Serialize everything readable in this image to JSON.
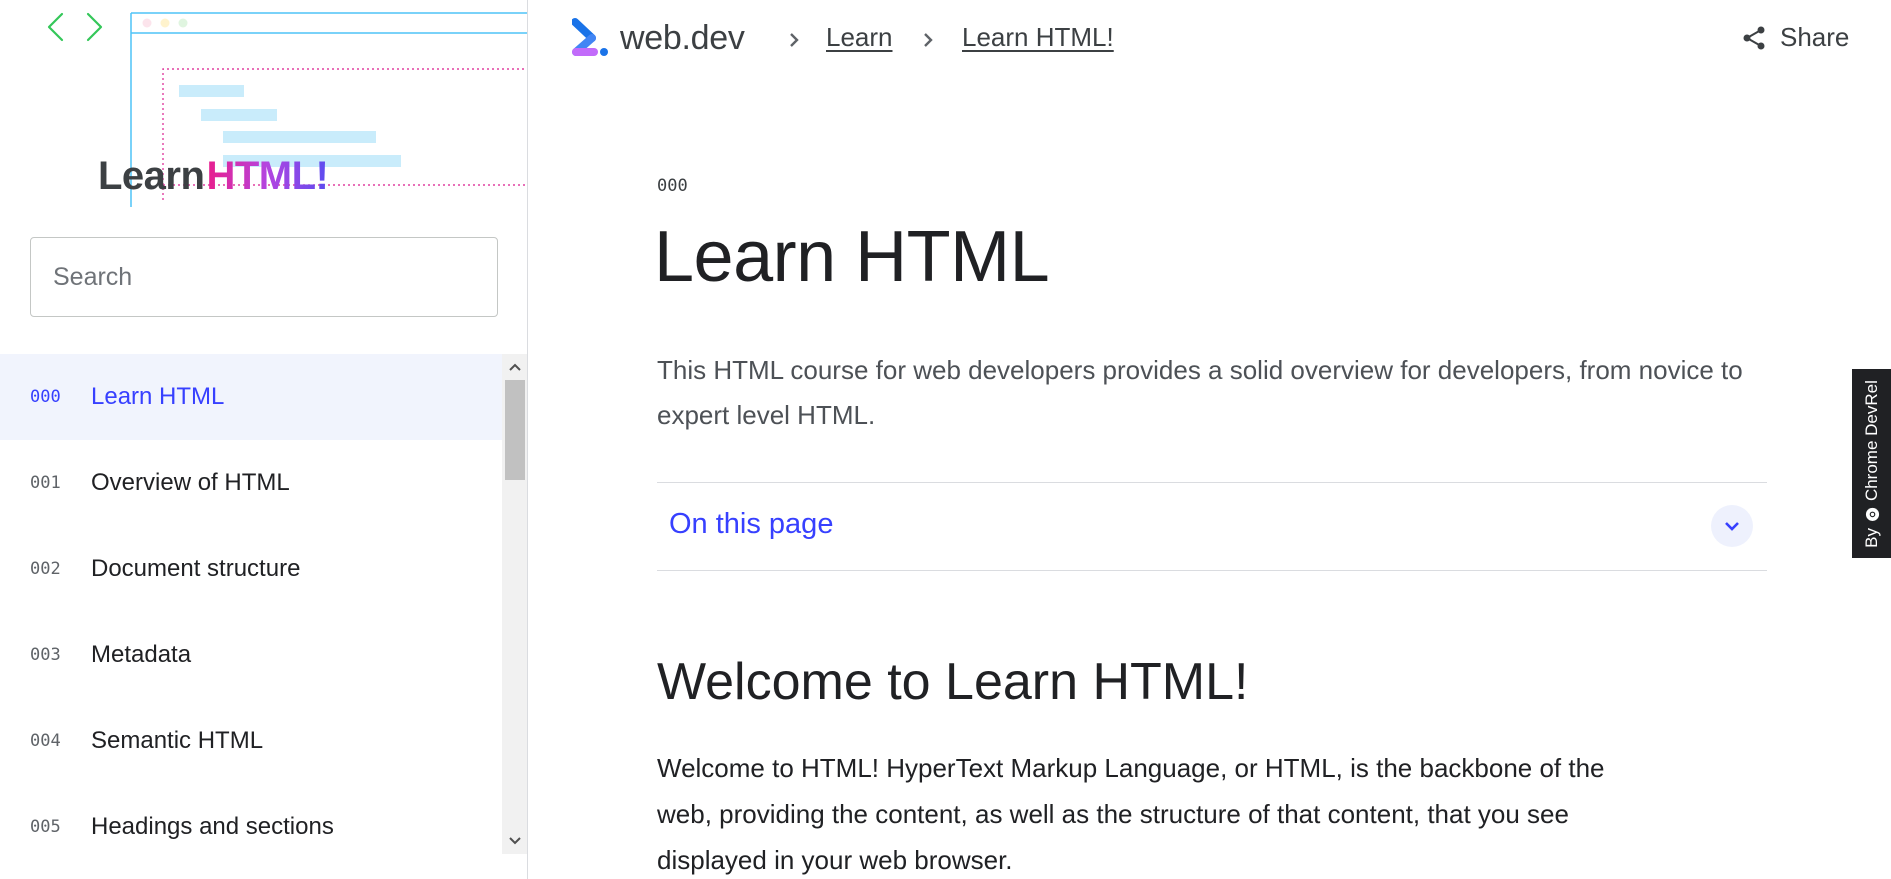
{
  "sidebar": {
    "hero": {
      "title_word1": "Learn",
      "title_word2": "HTML!"
    },
    "search": {
      "placeholder": "Search",
      "value": ""
    },
    "items": [
      {
        "num": "000",
        "label": "Learn HTML",
        "active": true
      },
      {
        "num": "001",
        "label": "Overview of HTML",
        "active": false
      },
      {
        "num": "002",
        "label": "Document structure",
        "active": false
      },
      {
        "num": "003",
        "label": "Metadata",
        "active": false
      },
      {
        "num": "004",
        "label": "Semantic HTML",
        "active": false
      },
      {
        "num": "005",
        "label": "Headings and sections",
        "active": false
      }
    ]
  },
  "header": {
    "brand": "web.dev",
    "breadcrumbs": [
      "Learn",
      "Learn HTML!"
    ],
    "share_label": "Share",
    "share_icon": "share-icon"
  },
  "main": {
    "page_number": "000",
    "title": "Learn HTML",
    "intro": "This HTML course for web developers provides a solid overview for developers, from novice to expert level HTML.",
    "toc_label": "On this page",
    "section_title": "Welcome to Learn HTML!",
    "body": "Welcome to HTML! HyperText Markup Language, or HTML, is the backbone of the web, providing the content, as well as the structure of that content, that you see displayed in your web browser."
  },
  "side_tab": {
    "by": "By",
    "label": "Chrome DevRel"
  },
  "colors": {
    "accent": "#3740ff",
    "active_bg": "#f1f4fd",
    "text": "#202124",
    "muted": "#5f6368",
    "hero_gradient": [
      "#e91e8c",
      "#5b4cf0"
    ]
  }
}
